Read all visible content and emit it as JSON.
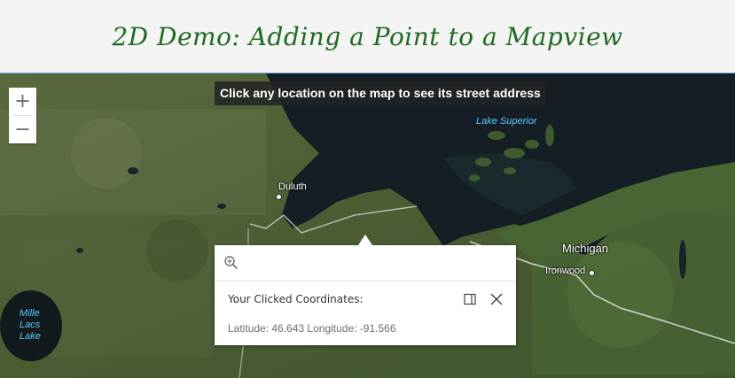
{
  "header": {
    "title": "2D Demo: Adding a Point to a Mapview"
  },
  "map": {
    "hint": "Click any location on the map to see its street address",
    "zoom_in_label": "+",
    "zoom_out_label": "−",
    "labels": {
      "lake_superior": "Lake Superior",
      "duluth": "Duluth",
      "michigan": "Michigan",
      "ironwood": "Ironwood",
      "mille_lacs_1": "Mille",
      "mille_lacs_2": "Lacs",
      "mille_lacs_3": "Lake"
    }
  },
  "popup": {
    "title": "Your Clicked Coordinates:",
    "coordinates": "Latitude: 46.643 Longitude: -91.566"
  }
}
